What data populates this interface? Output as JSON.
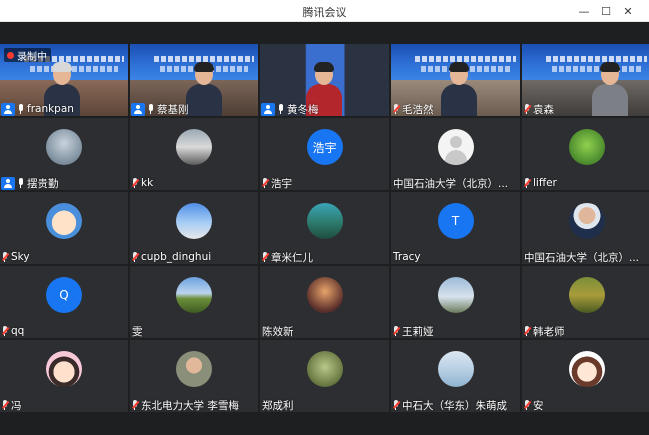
{
  "window": {
    "title": "腾讯会议",
    "minimize_glyph": "—",
    "maximize_glyph": "☐",
    "close_glyph": "✕"
  },
  "recording": {
    "label": "录制中"
  },
  "colors": {
    "host_tag": "#1876f2",
    "mic_muted": "#ff3b30",
    "active_border": "#3dbb72",
    "tile_bg": "#2d2e31",
    "stage_bg": "#1e1f21"
  },
  "participants": [
    {
      "name": "frankpan",
      "host": true,
      "mic": "on",
      "kind": "video"
    },
    {
      "name": "蔡基刚",
      "host": true,
      "mic": "on",
      "kind": "video"
    },
    {
      "name": "黄冬梅",
      "host": true,
      "mic": "on",
      "kind": "video",
      "active": true
    },
    {
      "name": "毛浩然",
      "host": false,
      "mic": "muted",
      "kind": "video"
    },
    {
      "name": "袁森",
      "host": false,
      "mic": "muted",
      "kind": "video"
    },
    {
      "name": "摆贵勤",
      "host": true,
      "mic": "on",
      "kind": "photo",
      "avatar_icon": "portrait-avatar-icon"
    },
    {
      "name": "kk",
      "host": false,
      "mic": "muted",
      "kind": "photo",
      "avatar_icon": "street-avatar-icon"
    },
    {
      "name": "浩宇",
      "host": false,
      "mic": "muted",
      "kind": "text",
      "avatar_text": "浩宇"
    },
    {
      "name": "中国石油大学（北京）...",
      "host": false,
      "mic": "none",
      "kind": "default",
      "avatar_icon": "default-user-icon"
    },
    {
      "name": "liffer",
      "host": false,
      "mic": "muted",
      "kind": "photo",
      "avatar_icon": "grass-avatar-icon"
    },
    {
      "name": "Sky",
      "host": false,
      "mic": "muted",
      "kind": "photo",
      "avatar_icon": "cartoon-avatar-icon"
    },
    {
      "name": "cupb_dinghui",
      "host": false,
      "mic": "muted",
      "kind": "photo",
      "avatar_icon": "sky-avatar-icon"
    },
    {
      "name": "章米仁儿",
      "host": false,
      "mic": "muted",
      "kind": "photo",
      "avatar_icon": "lake-avatar-icon"
    },
    {
      "name": "Tracy",
      "host": false,
      "mic": "none",
      "kind": "text",
      "avatar_text": "T"
    },
    {
      "name": "中国石油大学（北京）...",
      "host": false,
      "mic": "none",
      "kind": "photo",
      "avatar_icon": "man-avatar-icon"
    },
    {
      "name": "qq",
      "host": false,
      "mic": "muted",
      "kind": "text",
      "avatar_text": "Q"
    },
    {
      "name": "雯",
      "host": false,
      "mic": "none",
      "kind": "photo",
      "avatar_icon": "field-avatar-icon"
    },
    {
      "name": "陈效新",
      "host": false,
      "mic": "none",
      "kind": "photo",
      "avatar_icon": "palm-avatar-icon"
    },
    {
      "name": "王莉娅",
      "host": false,
      "mic": "muted",
      "kind": "photo",
      "avatar_icon": "tower-avatar-icon"
    },
    {
      "name": "韩老师",
      "host": false,
      "mic": "muted",
      "kind": "photo",
      "avatar_icon": "farmland-avatar-icon"
    },
    {
      "name": "冯",
      "host": false,
      "mic": "muted",
      "kind": "photo",
      "avatar_icon": "girl-cartoon-avatar-icon"
    },
    {
      "name": "东北电力大学 李雪梅",
      "host": false,
      "mic": "muted",
      "kind": "photo",
      "avatar_icon": "woman-avatar-icon"
    },
    {
      "name": "郑成利",
      "host": false,
      "mic": "none",
      "kind": "photo",
      "avatar_icon": "plant-avatar-icon"
    },
    {
      "name": "中石大（华东）朱萌成",
      "host": false,
      "mic": "muted",
      "kind": "photo",
      "avatar_icon": "sea-avatar-icon"
    },
    {
      "name": "安",
      "host": false,
      "mic": "muted",
      "kind": "photo",
      "avatar_icon": "girl-face-avatar-icon"
    }
  ]
}
